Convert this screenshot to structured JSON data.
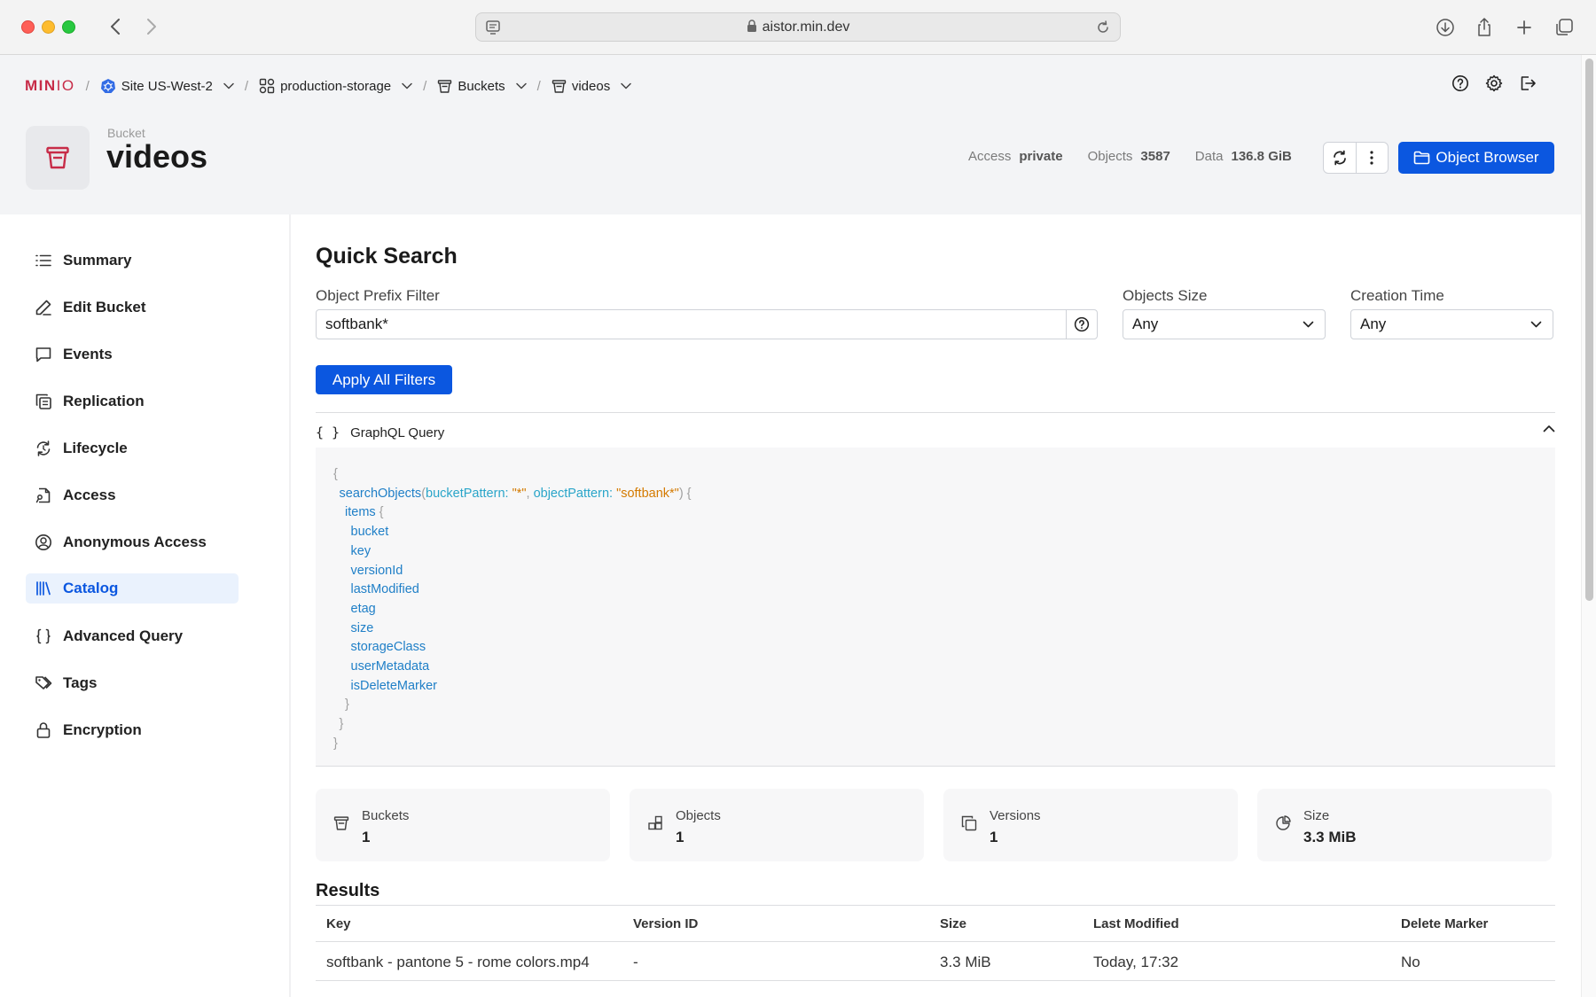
{
  "browser": {
    "url": "aistor.min.dev"
  },
  "breadcrumb": {
    "logo_main": "MIN",
    "logo_io": "IO",
    "items": [
      {
        "label": "Site US-West-2"
      },
      {
        "label": "production-storage"
      },
      {
        "label": "Buckets"
      },
      {
        "label": "videos"
      }
    ],
    "separator": "/"
  },
  "bucket": {
    "kicker": "Bucket",
    "name": "videos",
    "stats": [
      {
        "label": "Access",
        "value": "private"
      },
      {
        "label": "Objects",
        "value": "3587"
      },
      {
        "label": "Data",
        "value": "136.8 GiB"
      }
    ],
    "object_browser_label": "Object Browser"
  },
  "sidebar": {
    "items": [
      {
        "label": "Summary",
        "icon": "list-icon"
      },
      {
        "label": "Edit Bucket",
        "icon": "pencil-icon"
      },
      {
        "label": "Events",
        "icon": "chat-bubble-icon"
      },
      {
        "label": "Replication",
        "icon": "copy-icon"
      },
      {
        "label": "Lifecycle",
        "icon": "cycle-icon"
      },
      {
        "label": "Access",
        "icon": "document-key-icon"
      },
      {
        "label": "Anonymous Access",
        "icon": "user-circle-icon"
      },
      {
        "label": "Catalog",
        "icon": "library-icon",
        "active": true
      },
      {
        "label": "Advanced Query",
        "icon": "braces-icon"
      },
      {
        "label": "Tags",
        "icon": "tags-icon"
      },
      {
        "label": "Encryption",
        "icon": "lock-icon"
      }
    ]
  },
  "quick_search": {
    "title": "Quick Search",
    "prefix_label": "Object Prefix Filter",
    "prefix_value": "softbank*",
    "size_label": "Objects Size",
    "size_value": "Any",
    "time_label": "Creation Time",
    "time_value": "Any",
    "apply_label": "Apply All Filters"
  },
  "graphql": {
    "header_braces": "{ }",
    "header_label": "GraphQL Query",
    "lines": [
      {
        "indent": 0,
        "parts": [
          {
            "t": "{",
            "c": "punct"
          }
        ]
      },
      {
        "indent": 1,
        "parts": [
          {
            "t": "searchObjects",
            "c": "field"
          },
          {
            "t": "(",
            "c": "punct"
          },
          {
            "t": "bucketPattern: ",
            "c": "arg"
          },
          {
            "t": "\"*\"",
            "c": "str"
          },
          {
            "t": ", ",
            "c": "punct"
          },
          {
            "t": "objectPattern: ",
            "c": "arg"
          },
          {
            "t": "\"softbank*\"",
            "c": "str"
          },
          {
            "t": ") {",
            "c": "punct"
          }
        ]
      },
      {
        "indent": 2,
        "parts": [
          {
            "t": "items",
            "c": "field"
          },
          {
            "t": " {",
            "c": "punct"
          }
        ]
      },
      {
        "indent": 3,
        "parts": [
          {
            "t": "bucket",
            "c": "field"
          }
        ]
      },
      {
        "indent": 3,
        "parts": [
          {
            "t": "key",
            "c": "field"
          }
        ]
      },
      {
        "indent": 3,
        "parts": [
          {
            "t": "versionId",
            "c": "field"
          }
        ]
      },
      {
        "indent": 3,
        "parts": [
          {
            "t": "lastModified",
            "c": "field"
          }
        ]
      },
      {
        "indent": 3,
        "parts": [
          {
            "t": "etag",
            "c": "field"
          }
        ]
      },
      {
        "indent": 3,
        "parts": [
          {
            "t": "size",
            "c": "field"
          }
        ]
      },
      {
        "indent": 3,
        "parts": [
          {
            "t": "storageClass",
            "c": "field"
          }
        ]
      },
      {
        "indent": 3,
        "parts": [
          {
            "t": "userMetadata",
            "c": "field"
          }
        ]
      },
      {
        "indent": 3,
        "parts": [
          {
            "t": "isDeleteMarker",
            "c": "field"
          }
        ]
      },
      {
        "indent": 2,
        "parts": [
          {
            "t": "}",
            "c": "punct"
          }
        ]
      },
      {
        "indent": 1,
        "parts": [
          {
            "t": "}",
            "c": "punct"
          }
        ]
      },
      {
        "indent": 0,
        "parts": [
          {
            "t": "}",
            "c": "punct"
          }
        ]
      }
    ]
  },
  "summary_cards": [
    {
      "label": "Buckets",
      "value": "1",
      "icon": "bucket-icon"
    },
    {
      "label": "Objects",
      "value": "1",
      "icon": "objects-icon"
    },
    {
      "label": "Versions",
      "value": "1",
      "icon": "versions-icon"
    },
    {
      "label": "Size",
      "value": "3.3 MiB",
      "icon": "pie-icon"
    }
  ],
  "results": {
    "title": "Results",
    "columns": [
      "Key",
      "Version ID",
      "Size",
      "Last Modified",
      "Delete Marker"
    ],
    "rows": [
      [
        "softbank - pantone 5 - rome colors.mp4",
        "-",
        "3.3 MiB",
        "Today, 17:32",
        "No"
      ]
    ]
  },
  "colors": {
    "brand": "#c72c48",
    "primary": "#0b57e0",
    "active_bg": "#eaf2fd"
  }
}
